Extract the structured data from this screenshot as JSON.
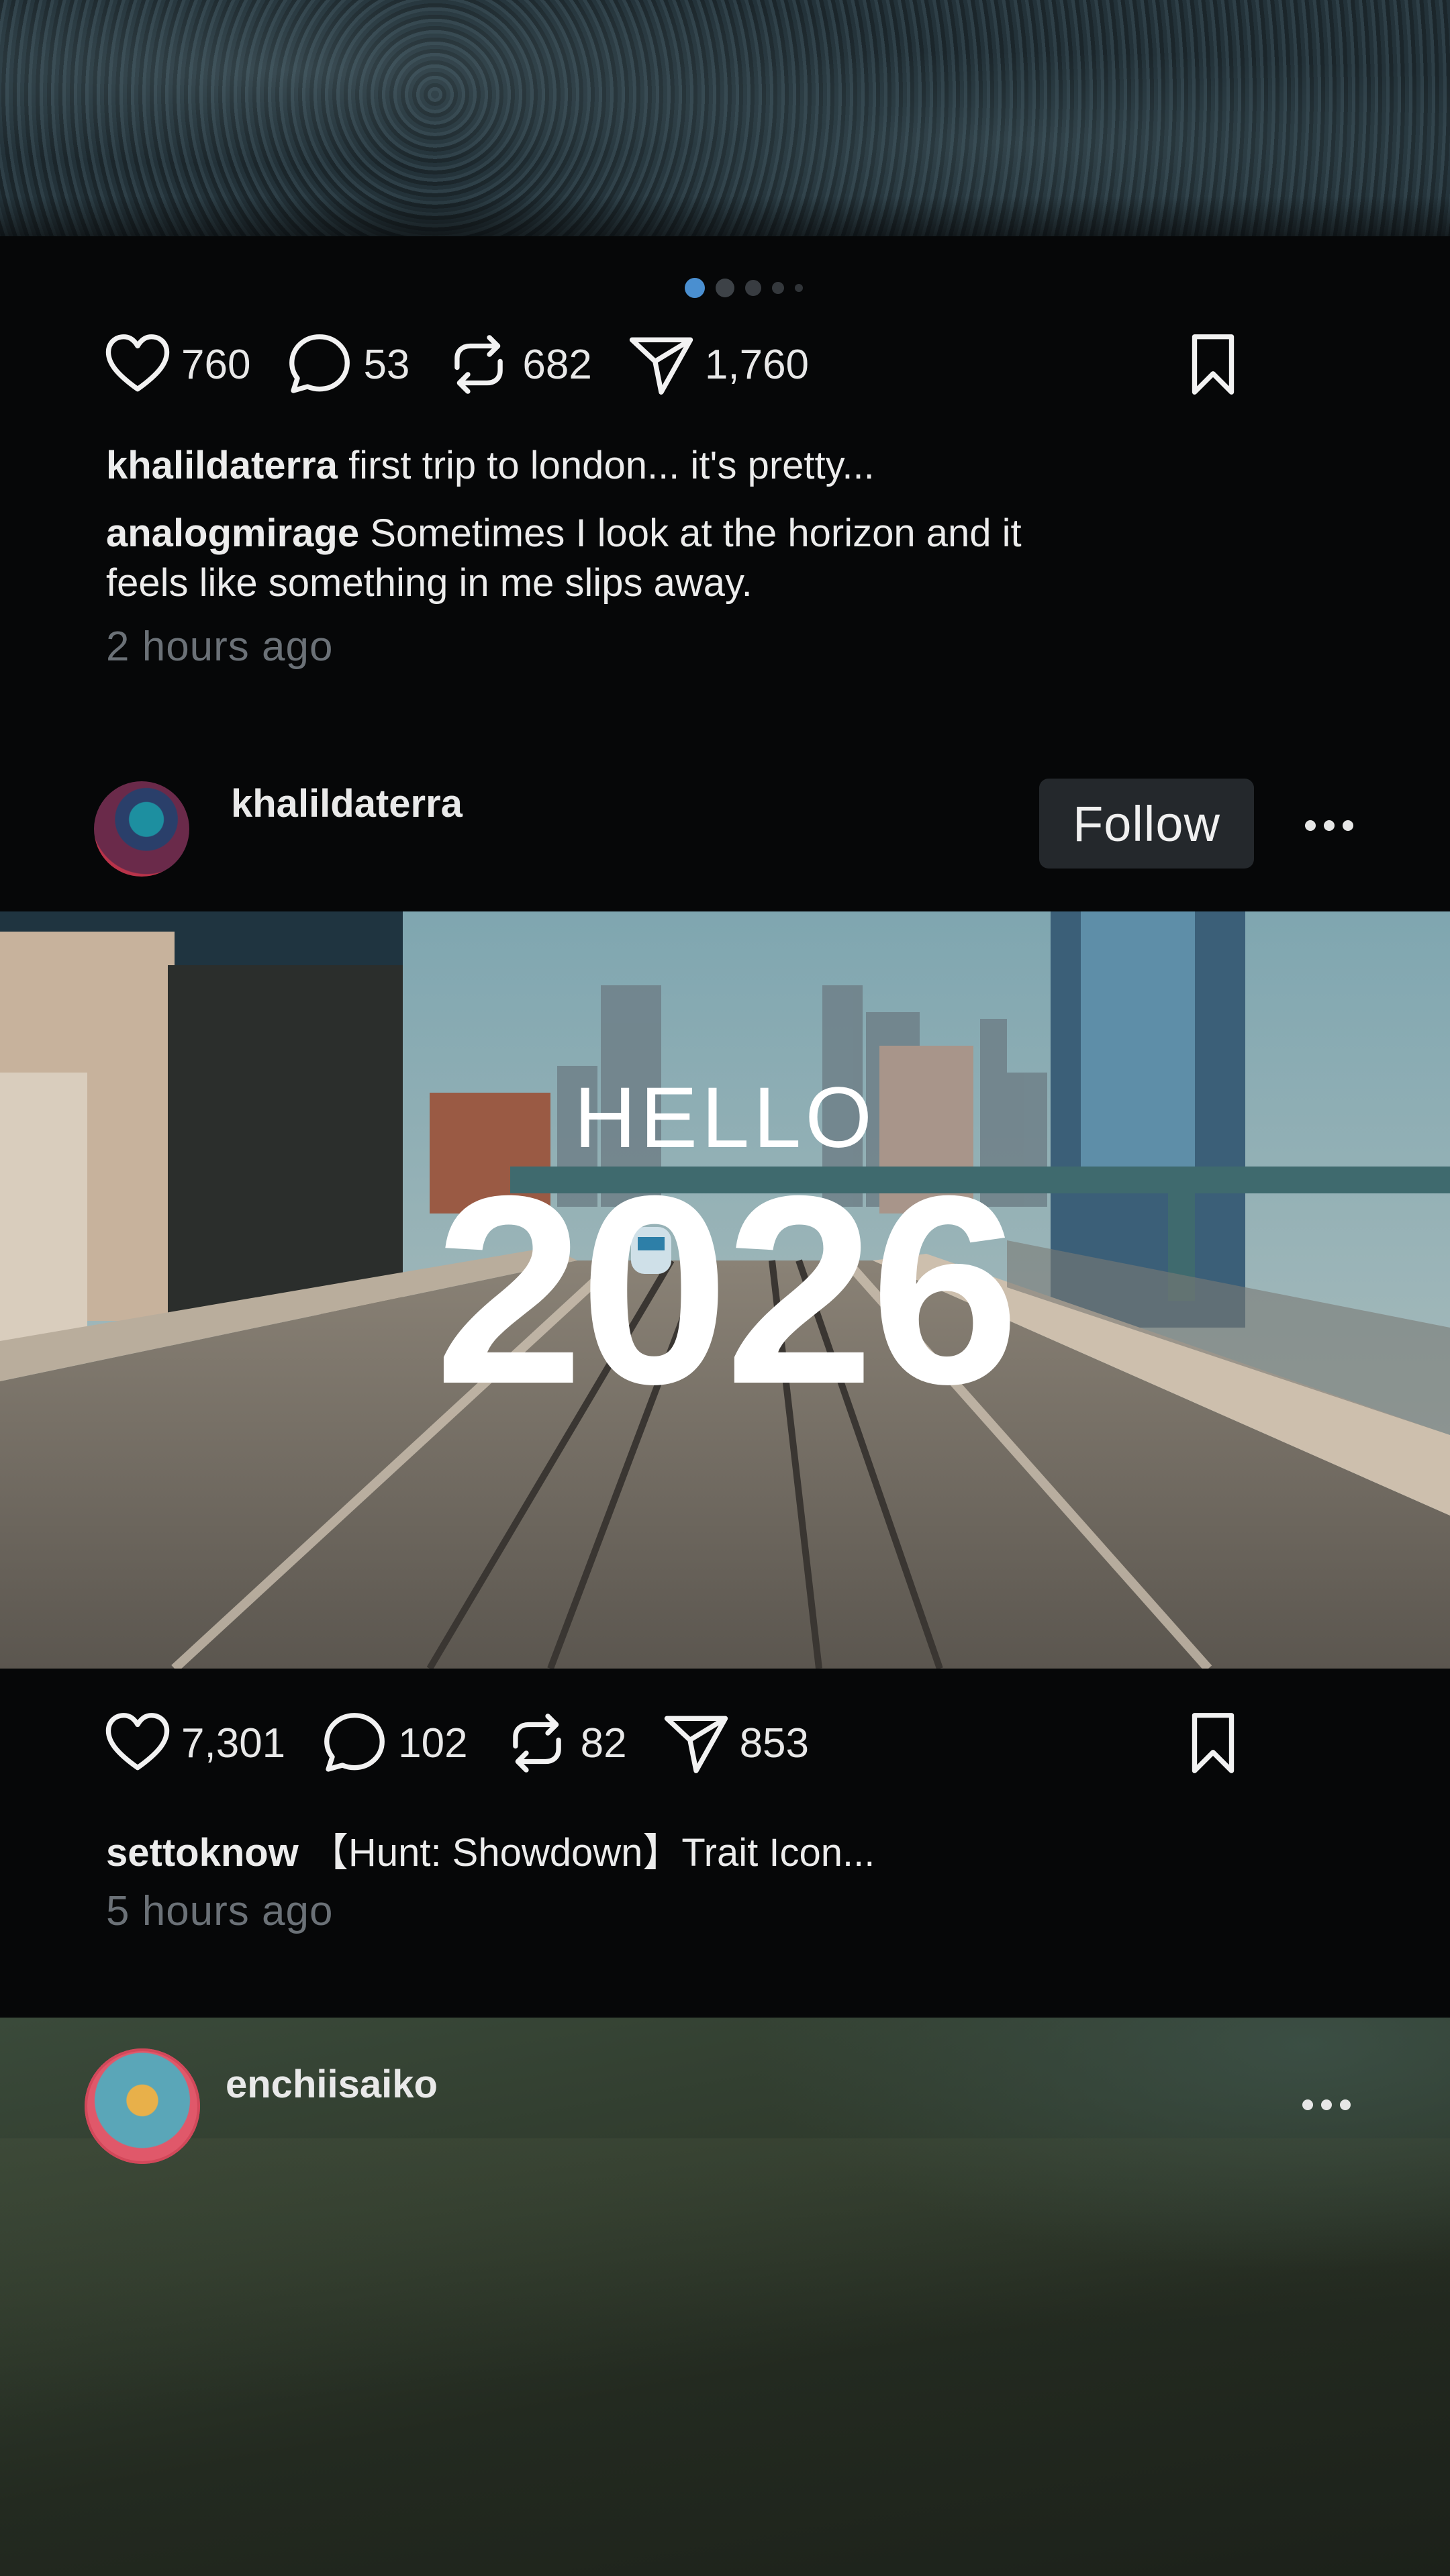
{
  "post1": {
    "carousel": {
      "total": 5,
      "active": 1
    },
    "actions": {
      "likes": "760",
      "comments": "53",
      "reposts": "682",
      "shares": "1,760"
    },
    "caption": {
      "user": "khalildaterra",
      "text": " first trip to london... it's pretty..."
    },
    "comment": {
      "user": "analogmirage",
      "text_line1": " Sometimes I look at the horizon and it",
      "text_line2": "feels like something in me slips away."
    },
    "time": "2 hours ago"
  },
  "post2": {
    "username": "khalildaterra",
    "follow_label": "Follow",
    "overlay": {
      "hello": "HELLO",
      "year": "2026"
    },
    "actions": {
      "likes": "7,301",
      "comments": "102",
      "reposts": "82",
      "shares": "853"
    },
    "caption": {
      "user": "settoknow",
      "text": " 【Hunt: Showdown】Trait Icon..."
    },
    "time": "5 hours ago"
  },
  "post3": {
    "username": "enchiisaiko"
  },
  "colors": {
    "background": "#060708",
    "dot_active": "#4a8fd0",
    "follow_bg": "#24282c",
    "time_text": "#6b7177"
  }
}
